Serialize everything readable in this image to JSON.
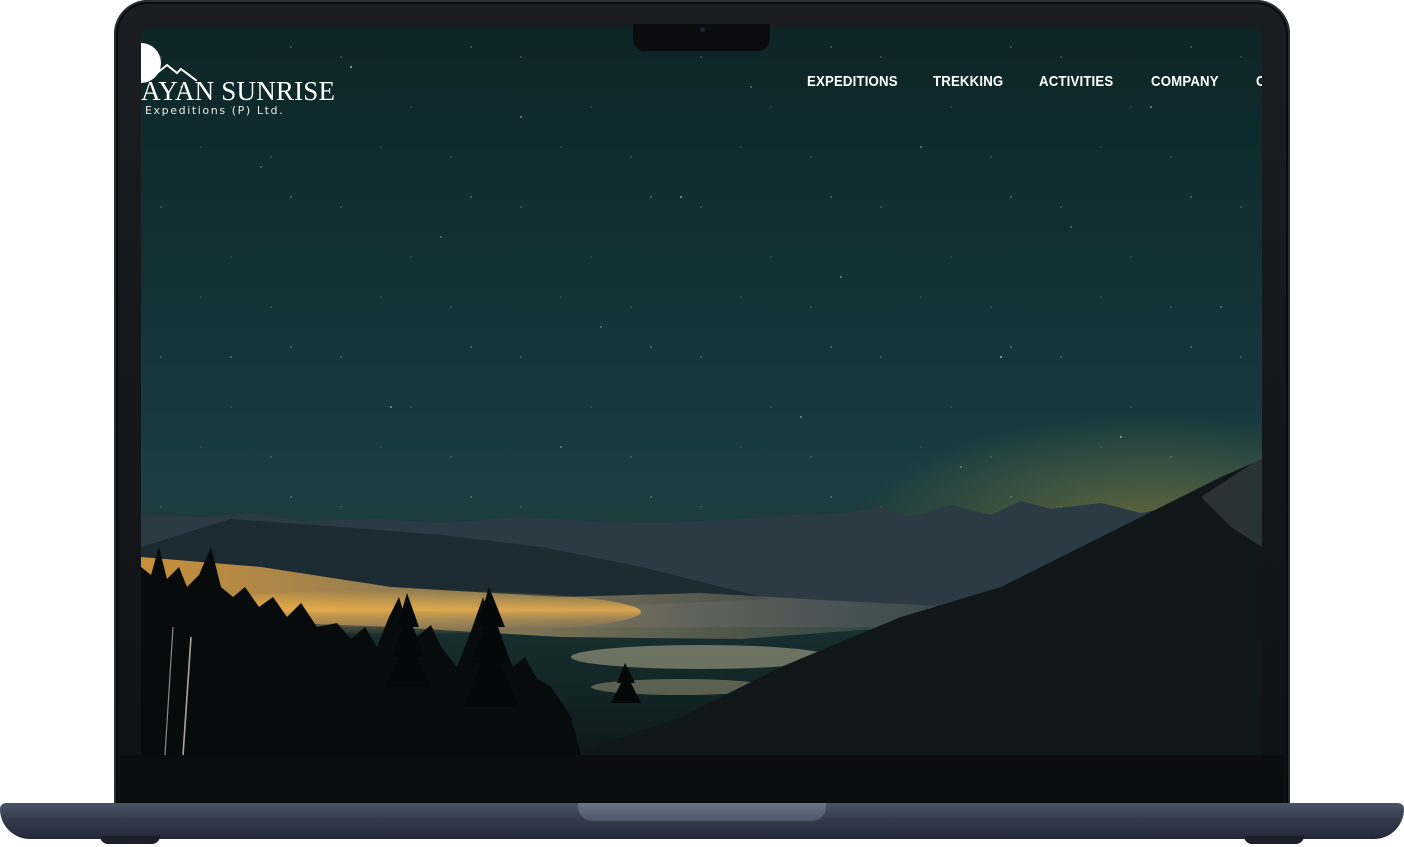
{
  "site": {
    "logo_title": "AYAN SUNRISE",
    "logo_subtitle": "Expeditions (P) Ltd."
  },
  "nav": {
    "items": [
      {
        "label": "EXPEDITIONS"
      },
      {
        "label": "TREKKING"
      },
      {
        "label": "ACTIVITIES"
      },
      {
        "label": "COMPANY"
      },
      {
        "label": "C"
      }
    ]
  },
  "colors": {
    "sky_top": "#0d2527",
    "sky_horizon_glow": "#968c3c",
    "nav_text": "#ffffff",
    "laptop_body": "#343c4c"
  },
  "icons": {
    "logo_mark": "moon-mountain-icon"
  }
}
